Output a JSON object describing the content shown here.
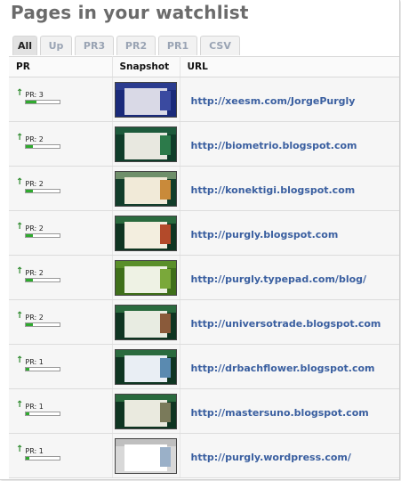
{
  "page": {
    "title": "Pages in your watchlist"
  },
  "tabs": [
    "All",
    "Up",
    "PR3",
    "PR2",
    "PR1",
    "CSV"
  ],
  "table": {
    "headers": {
      "pr": "PR",
      "snapshot": "Snapshot",
      "url": "URL"
    },
    "rows": [
      {
        "pr_label": "PR: 3",
        "pr_level": 0.3,
        "url": "http://xeesm.com/JorgePurgly",
        "thumb": {
          "bg": "#1a2a7a",
          "hdr": "#2b3c8f",
          "body": "#d9d9e6",
          "side": "#3a4aa0"
        }
      },
      {
        "pr_label": "PR: 2",
        "pr_level": 0.2,
        "url": "http://biometrio.blogspot.com",
        "thumb": {
          "bg": "#0f3d2a",
          "hdr": "#1d5a3c",
          "body": "#e8e8e0",
          "side": "#2c7a4a"
        }
      },
      {
        "pr_label": "PR: 2",
        "pr_level": 0.2,
        "url": "http://konektigi.blogspot.com",
        "thumb": {
          "bg": "#123d2a",
          "hdr": "#6f8f6a",
          "body": "#f1ead8",
          "side": "#c98a3a"
        }
      },
      {
        "pr_label": "PR: 2",
        "pr_level": 0.2,
        "url": "http://purgly.blogspot.com",
        "thumb": {
          "bg": "#0f3522",
          "hdr": "#2a6a3e",
          "body": "#f3eedf",
          "side": "#b34a2a"
        }
      },
      {
        "pr_label": "PR: 2",
        "pr_level": 0.2,
        "url": "http://purgly.typepad.com/blog/",
        "thumb": {
          "bg": "#3f6f1a",
          "hdr": "#5a8f2a",
          "body": "#eef2e4",
          "side": "#7aa83a"
        }
      },
      {
        "pr_label": "PR: 2",
        "pr_level": 0.2,
        "url": "http://universotrade.blogspot.com",
        "thumb": {
          "bg": "#0f3522",
          "hdr": "#2a6a3e",
          "body": "#e8ece2",
          "side": "#8a5a3a"
        }
      },
      {
        "pr_label": "PR: 1",
        "pr_level": 0.1,
        "url": "http://drbachflower.blogspot.com",
        "thumb": {
          "bg": "#0f3522",
          "hdr": "#2a6a3e",
          "body": "#e9eef4",
          "side": "#5a8ab0"
        }
      },
      {
        "pr_label": "PR: 1",
        "pr_level": 0.1,
        "url": "http://mastersuno.blogspot.com",
        "thumb": {
          "bg": "#0f3522",
          "hdr": "#2a6a3e",
          "body": "#eaeadf",
          "side": "#7a7a5a"
        }
      },
      {
        "pr_label": "PR: 1",
        "pr_level": 0.1,
        "url": "http://purgly.wordpress.com/",
        "thumb": {
          "bg": "#d8d8d8",
          "hdr": "#bfbfbf",
          "body": "#ffffff",
          "side": "#9ab0c8"
        }
      }
    ]
  },
  "colors": {
    "title": "#6b6b6b",
    "link": "#3a5fa0",
    "up_arrow": "#2e8b2e",
    "pr_fill": "#2faa2f"
  },
  "icons": {
    "pr_trend": "up-arrow-icon"
  }
}
